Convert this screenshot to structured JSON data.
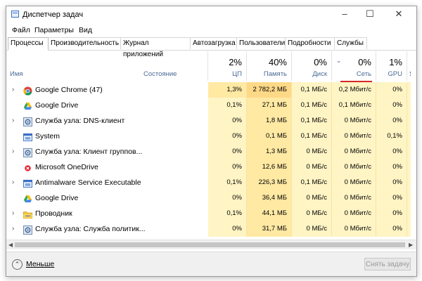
{
  "window": {
    "title": "Диспетчер задач"
  },
  "menu": [
    "Файл",
    "Параметры",
    "Вид"
  ],
  "tabs": [
    "Процессы",
    "Производительность",
    "Журнал приложений",
    "Автозагрузка",
    "Пользователи",
    "Подробности",
    "Службы"
  ],
  "columns": {
    "name": "Имя",
    "status": "Состояние",
    "cpu": {
      "pct": "2%",
      "label": "ЦП"
    },
    "mem": {
      "pct": "40%",
      "label": "Память"
    },
    "disk": {
      "pct": "0%",
      "label": "Диск"
    },
    "net": {
      "pct": "0%",
      "label": "Сеть"
    },
    "gpu": {
      "pct": "1%",
      "label": "GPU"
    },
    "extra": {
      "label": "Яд"
    }
  },
  "rows": [
    {
      "name": "Google Chrome (47)",
      "icon": "chrome-icon",
      "expand": true,
      "cpu": "1,3%",
      "mem": "2 782,2 МБ",
      "disk": "0,1 МБ/с",
      "net": "0,2 Мбит/с",
      "gpu": "0%",
      "mem_high": true
    },
    {
      "name": "Google Drive",
      "icon": "google-drive-icon",
      "expand": false,
      "cpu": "0,1%",
      "mem": "27,1 МБ",
      "disk": "0,1 МБ/с",
      "net": "0,1 Мбит/с",
      "gpu": "0%"
    },
    {
      "name": "Служба узла: DNS-клиент",
      "icon": "service-gear-icon",
      "expand": true,
      "cpu": "0%",
      "mem": "1,8 МБ",
      "disk": "0,1 МБ/с",
      "net": "0 Мбит/с",
      "gpu": "0%"
    },
    {
      "name": "System",
      "icon": "system-window-icon",
      "expand": false,
      "cpu": "0%",
      "mem": "0,1 МБ",
      "disk": "0,1 МБ/с",
      "net": "0 Мбит/с",
      "gpu": "0,1%"
    },
    {
      "name": "Служба узла: Клиент группов...",
      "icon": "service-gear-icon",
      "expand": true,
      "cpu": "0%",
      "mem": "1,3 МБ",
      "disk": "0 МБ/с",
      "net": "0 Мбит/с",
      "gpu": "0%"
    },
    {
      "name": "Microsoft OneDrive",
      "icon": "onedrive-error-icon",
      "expand": false,
      "cpu": "0%",
      "mem": "12,6 МБ",
      "disk": "0 МБ/с",
      "net": "0 Мбит/с",
      "gpu": "0%"
    },
    {
      "name": "Antimalware Service Executable",
      "icon": "system-window-icon",
      "expand": true,
      "cpu": "0,1%",
      "mem": "226,3 МБ",
      "disk": "0,1 МБ/с",
      "net": "0 Мбит/с",
      "gpu": "0%"
    },
    {
      "name": "Google Drive",
      "icon": "google-drive-icon",
      "expand": false,
      "cpu": "0%",
      "mem": "36,4 МБ",
      "disk": "0 МБ/с",
      "net": "0 Мбит/с",
      "gpu": "0%"
    },
    {
      "name": "Проводник",
      "icon": "explorer-folder-icon",
      "expand": true,
      "cpu": "0,1%",
      "mem": "44,1 МБ",
      "disk": "0 МБ/с",
      "net": "0 Мбит/с",
      "gpu": "0%"
    },
    {
      "name": "Служба узла: Служба политик...",
      "icon": "service-gear-icon",
      "expand": true,
      "cpu": "0%",
      "mem": "31,7 МБ",
      "disk": "0 МБ/с",
      "net": "0 Мбит/с",
      "gpu": "0%"
    }
  ],
  "footer": {
    "less": "Меньше",
    "end_task": "Снять задачу"
  },
  "colors": {
    "heat_low": "#fff4c4",
    "heat_mid": "#ffe9a3",
    "heat_high": "#fdd987",
    "accent_red": "#d62828",
    "link_blue": "#4a6a96"
  }
}
